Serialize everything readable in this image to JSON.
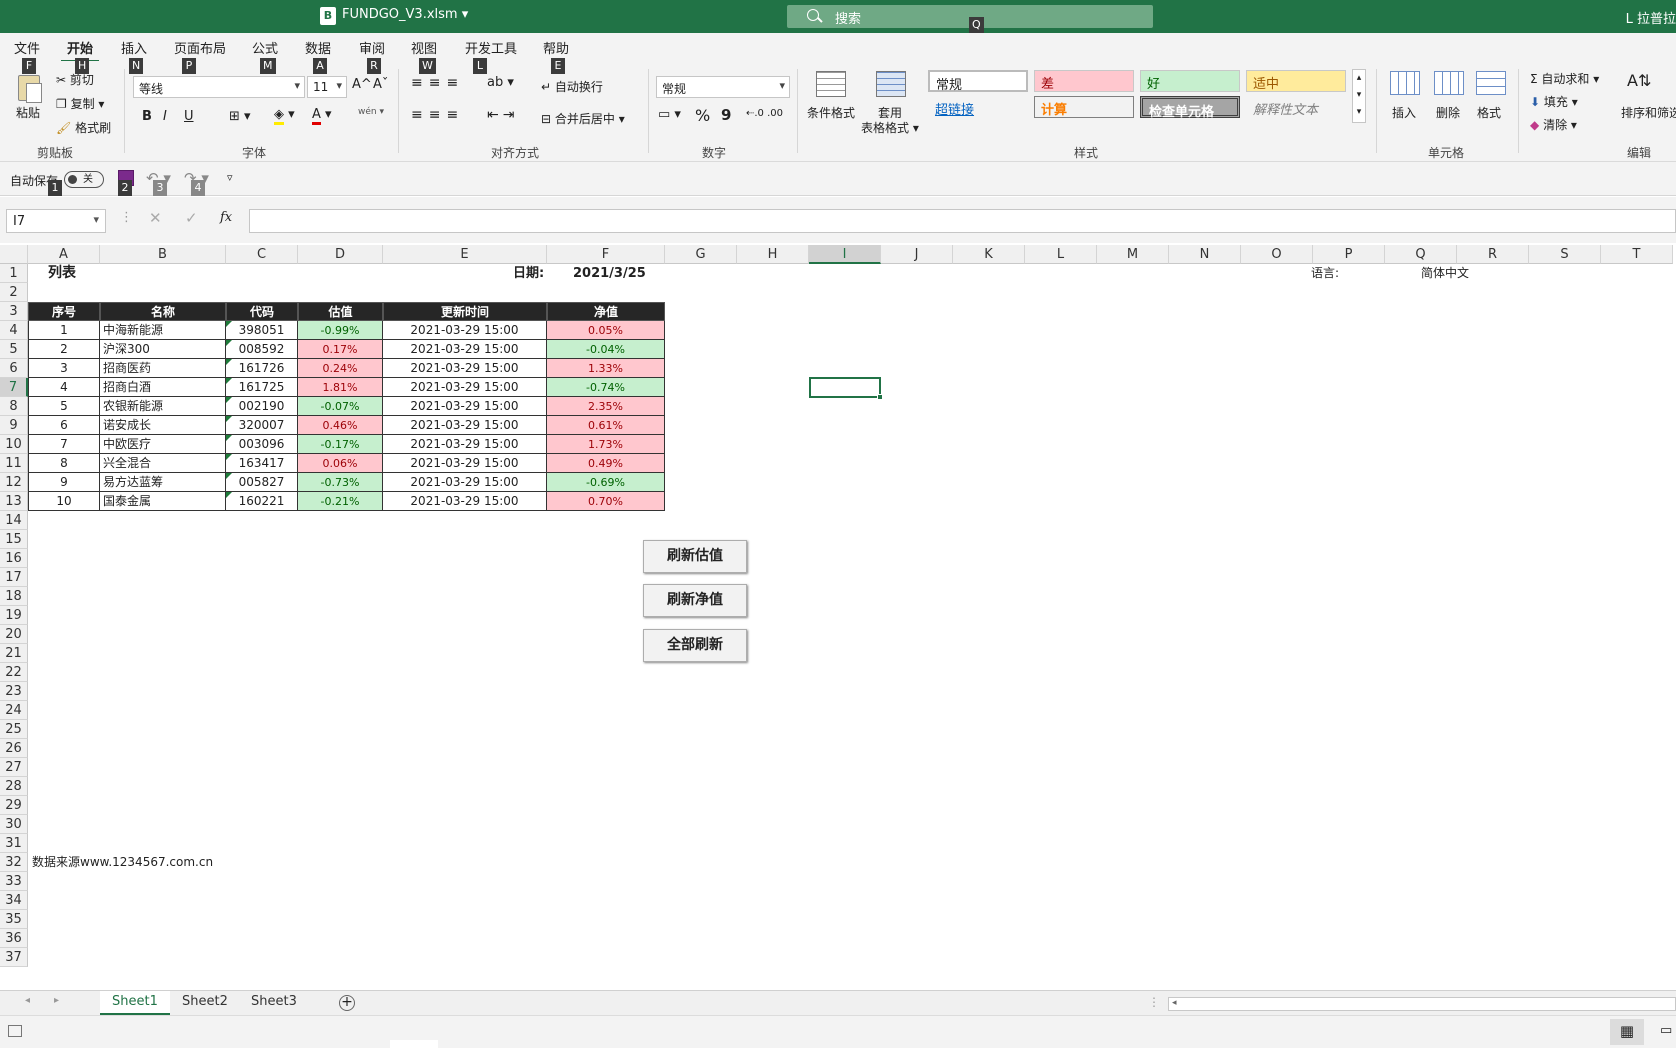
{
  "app": {
    "file_icon": "B",
    "title": "FUNDGO_V3.xlsm",
    "search_placeholder": "搜索",
    "user": "L 拉普拉"
  },
  "tabs": [
    "文件",
    "开始",
    "插入",
    "页面布局",
    "公式",
    "数据",
    "审阅",
    "视图",
    "开发工具",
    "帮助"
  ],
  "keytips": {
    "tabs": [
      "F",
      "H",
      "N",
      "P",
      "M",
      "A",
      "R",
      "W",
      "L",
      "E"
    ],
    "search": "Q",
    "qat": [
      "1",
      "2",
      "3",
      "4"
    ]
  },
  "ribbon": {
    "clipboard": {
      "paste": "粘贴",
      "cut": "剪切",
      "copy": "复制",
      "format_painter": "格式刷",
      "label": "剪贴板"
    },
    "font": {
      "name": "等线",
      "size": "11",
      "label": "字体",
      "grow": "A^",
      "shrink": "Aˇ",
      "bold": "B",
      "italic": "I",
      "underline": "U",
      "font_color": "A",
      "wen": "wén"
    },
    "alignment": {
      "wrap": "自动换行",
      "merge": "合并后居中",
      "label": "对齐方式"
    },
    "number": {
      "format": "常规",
      "label": "数字",
      "percent": "%",
      "comma": "9"
    },
    "styles": {
      "cond_format": "条件格式",
      "table_format_1": "套用",
      "table_format_2": "表格格式",
      "label": "样式",
      "cells": [
        "常规",
        "差",
        "好",
        "适中",
        "超链接",
        "计算",
        "检查单元格",
        "解释性文本"
      ]
    },
    "cells": {
      "insert": "插入",
      "delete": "删除",
      "format": "格式",
      "label": "单元格"
    },
    "editing": {
      "autosum": "自动求和",
      "fill": "填充",
      "clear": "清除",
      "sort": "排序和筛选",
      "label": "编辑"
    }
  },
  "qat": {
    "autosave": "自动保存",
    "toggle": "关"
  },
  "formula_bar": {
    "name_box": "I7",
    "fx": "fx",
    "content": ""
  },
  "columns": [
    "A",
    "B",
    "C",
    "D",
    "E",
    "F",
    "G",
    "H",
    "I",
    "J",
    "K",
    "L",
    "M",
    "N",
    "O",
    "P",
    "Q",
    "R",
    "S",
    "T"
  ],
  "selected_column": "I",
  "rows": [
    "1",
    "2",
    "3",
    "4",
    "5",
    "6",
    "7",
    "8",
    "9",
    "10",
    "11",
    "12",
    "13",
    "14",
    "15",
    "16",
    "17",
    "18",
    "19",
    "20",
    "21",
    "22",
    "23",
    "24",
    "25",
    "26",
    "27",
    "28",
    "29",
    "30",
    "31",
    "32",
    "33",
    "34",
    "35",
    "36",
    "37"
  ],
  "selected_row": "7",
  "sheet": {
    "title": "列表",
    "date_label": "日期:",
    "date_value": "2021/3/25",
    "lang_label": "语言:",
    "lang_value": "简体中文",
    "headers": [
      "序号",
      "名称",
      "代码",
      "估值",
      "更新时间",
      "净值"
    ],
    "table": [
      {
        "no": "1",
        "name": "中海新能源",
        "code": "398051",
        "est": "-0.99%",
        "est_up": false,
        "time": "2021-03-29 15:00",
        "nav": "0.05%",
        "nav_up": true
      },
      {
        "no": "2",
        "name": "沪深300",
        "code": "008592",
        "est": "0.17%",
        "est_up": true,
        "time": "2021-03-29 15:00",
        "nav": "-0.04%",
        "nav_up": false
      },
      {
        "no": "3",
        "name": "招商医药",
        "code": "161726",
        "est": "0.24%",
        "est_up": true,
        "time": "2021-03-29 15:00",
        "nav": "1.33%",
        "nav_up": true
      },
      {
        "no": "4",
        "name": "招商白酒",
        "code": "161725",
        "est": "1.81%",
        "est_up": true,
        "time": "2021-03-29 15:00",
        "nav": "-0.74%",
        "nav_up": false
      },
      {
        "no": "5",
        "name": "农银新能源",
        "code": "002190",
        "est": "-0.07%",
        "est_up": false,
        "time": "2021-03-29 15:00",
        "nav": "2.35%",
        "nav_up": true
      },
      {
        "no": "6",
        "name": "诺安成长",
        "code": "320007",
        "est": "0.46%",
        "est_up": true,
        "time": "2021-03-29 15:00",
        "nav": "0.61%",
        "nav_up": true
      },
      {
        "no": "7",
        "name": "中欧医疗",
        "code": "003096",
        "est": "-0.17%",
        "est_up": false,
        "time": "2021-03-29 15:00",
        "nav": "1.73%",
        "nav_up": true
      },
      {
        "no": "8",
        "name": "兴全混合",
        "code": "163417",
        "est": "0.06%",
        "est_up": true,
        "time": "2021-03-29 15:00",
        "nav": "0.49%",
        "nav_up": true
      },
      {
        "no": "9",
        "name": "易方达蓝筹",
        "code": "005827",
        "est": "-0.73%",
        "est_up": false,
        "time": "2021-03-29 15:00",
        "nav": "-0.69%",
        "nav_up": false
      },
      {
        "no": "10",
        "name": "国泰金属",
        "code": "160221",
        "est": "-0.21%",
        "est_up": false,
        "time": "2021-03-29 15:00",
        "nav": "0.70%",
        "nav_up": true
      }
    ],
    "buttons": [
      "刷新估值",
      "刷新净值",
      "全部刷新"
    ],
    "footer": "数据来源www.1234567.com.cn"
  },
  "sheet_tabs": [
    "Sheet1",
    "Sheet2",
    "Sheet3"
  ],
  "colors": {
    "brand": "#217346",
    "up_bg": "#ffc7ce",
    "up_fg": "#9c0006",
    "down_bg": "#c6efce",
    "down_fg": "#006100",
    "header_bg": "#262626"
  }
}
